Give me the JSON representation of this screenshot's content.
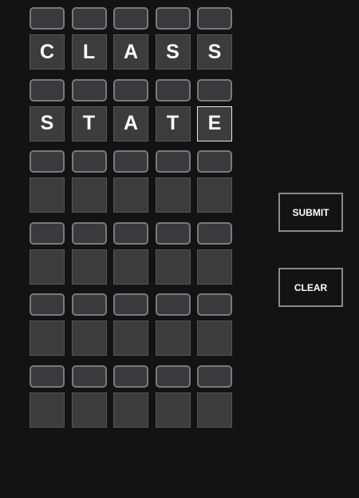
{
  "board": {
    "rows": [
      {
        "letters": [
          "C",
          "L",
          "A",
          "S",
          "S"
        ]
      },
      {
        "letters": [
          "S",
          "T",
          "A",
          "T",
          "E"
        ]
      },
      {
        "letters": [
          "",
          "",
          "",
          "",
          ""
        ]
      },
      {
        "letters": [
          "",
          "",
          "",
          "",
          ""
        ]
      },
      {
        "letters": [
          "",
          "",
          "",
          "",
          ""
        ]
      },
      {
        "letters": [
          "",
          "",
          "",
          "",
          ""
        ]
      }
    ]
  },
  "controls": {
    "submit_label": "SUBMIT",
    "clear_label": "CLEAR"
  },
  "colors": {
    "background": "#131313",
    "tile": "#3c3c3c",
    "hint": "#3a3a3c",
    "active_border": "#e8e8e8"
  }
}
